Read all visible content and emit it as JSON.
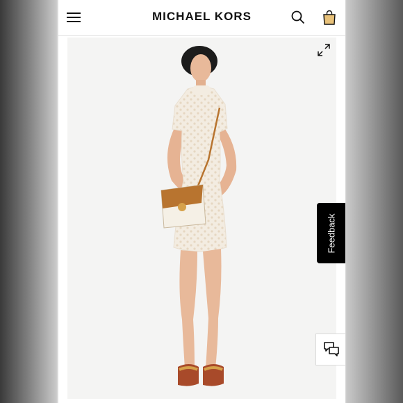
{
  "header": {
    "brand": "MICHAEL KORS",
    "icons": [
      "hamburger-menu-icon",
      "search-icon",
      "shopping-bag-icon"
    ]
  },
  "media": {
    "icons": [
      "expand-icon"
    ],
    "colors": {
      "dress": "#f3ece1",
      "pattern": "#e6d7c2",
      "strap": "#b8742f",
      "background": "#f4f4f3"
    }
  },
  "feedback": {
    "label": "Feedback"
  },
  "chat": {
    "icon": "chat-bubbles-icon"
  }
}
